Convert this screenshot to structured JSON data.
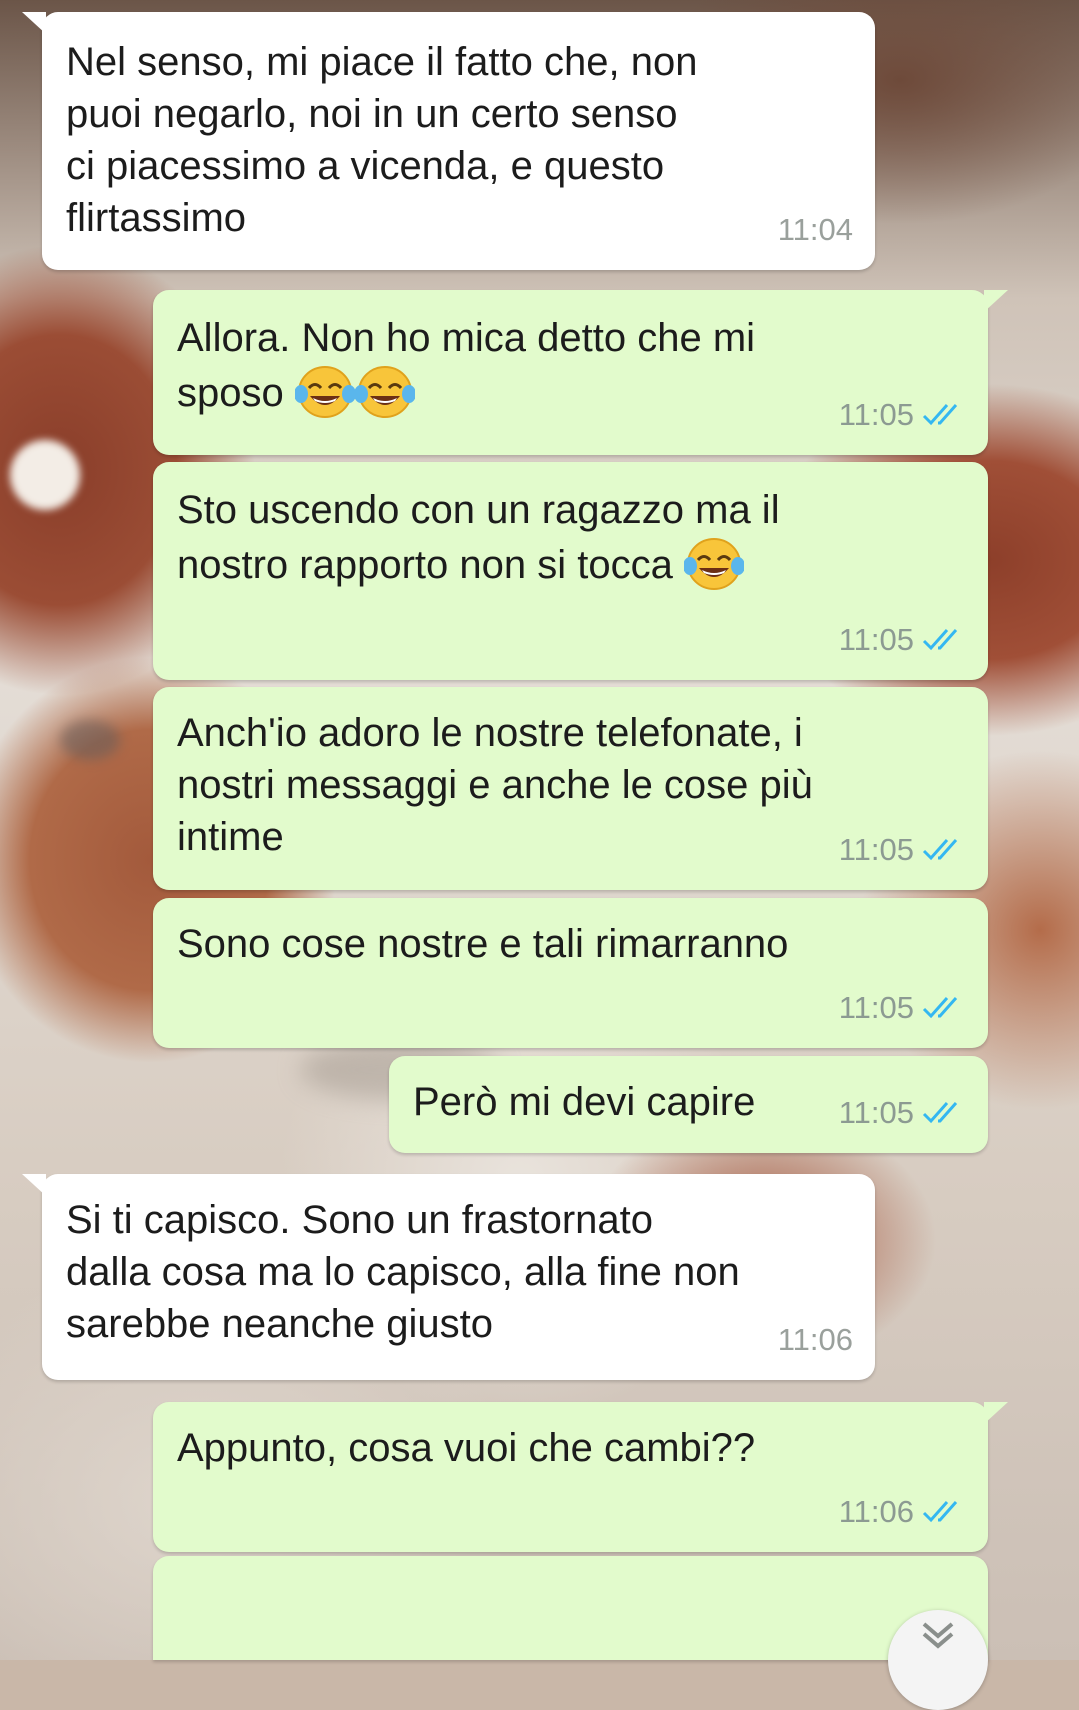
{
  "chat": {
    "messages": [
      {
        "direction": "in",
        "text": "Nel senso, mi piace il fatto che, non\npuoi negarlo, noi in un certo senso\nci piacessimo a vicenda, e questo\nflirtassimo",
        "time": "11:04"
      },
      {
        "direction": "out",
        "text": "Allora. Non ho mica detto che mi\nsposo",
        "emoji_count": 2,
        "time": "11:05",
        "status": "read"
      },
      {
        "direction": "out",
        "text": "Sto uscendo con un ragazzo ma il\nnostro rapporto non si tocca",
        "emoji_count": 1,
        "time": "11:05",
        "status": "read"
      },
      {
        "direction": "out",
        "text": "Anch'io adoro le nostre telefonate, i\nnostri messaggi e anche le cose più\nintime",
        "time": "11:05",
        "status": "read"
      },
      {
        "direction": "out",
        "text": "Sono cose nostre e tali rimarranno",
        "time": "11:05",
        "status": "read"
      },
      {
        "direction": "out",
        "text": "Però mi devi capire",
        "time": "11:05",
        "status": "read"
      },
      {
        "direction": "in",
        "text": "Si ti capisco. Sono un frastornato\ndalla cosa ma lo capisco, alla fine non\nsarebbe neanche giusto",
        "time": "11:06"
      },
      {
        "direction": "out",
        "text": "Appunto, cosa vuoi che cambi??",
        "time": "11:06",
        "status": "read"
      }
    ]
  },
  "icons": {
    "emoji": "face-with-tears-of-joy-icon",
    "read_receipt": "double-check-icon",
    "scroll_down": "chevron-down-icon"
  },
  "colors": {
    "incoming_bubble": "#ffffff",
    "outgoing_bubble": "#e2fbcc",
    "read_tick": "#34b7f1",
    "timestamp": "#8c9a92"
  }
}
